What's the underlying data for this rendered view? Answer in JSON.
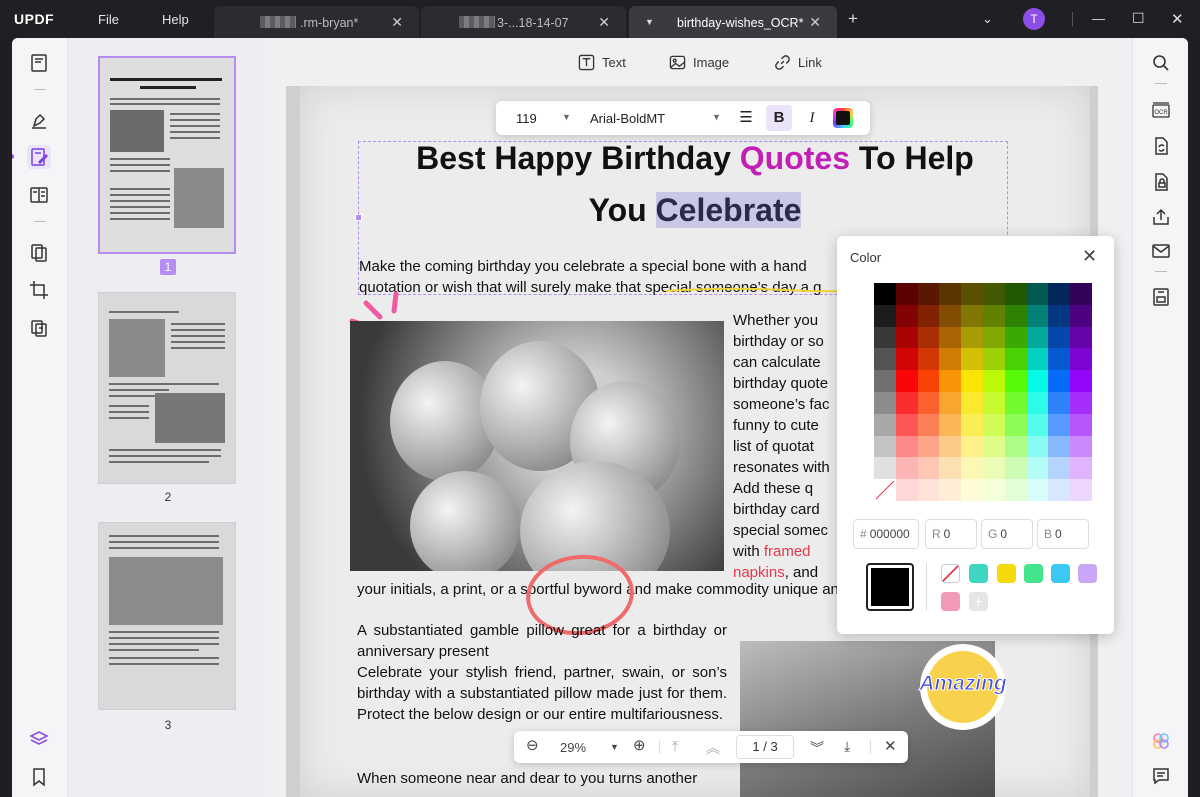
{
  "titlebar": {
    "logo": "UPDF",
    "menus": [
      "File",
      "Help"
    ],
    "tabs": [
      {
        "label": ".rm-bryan*"
      },
      {
        "label": "3-...18-14-07"
      },
      {
        "label": "birthday-wishes_OCR*"
      }
    ],
    "avatar_initial": "T"
  },
  "modes": {
    "text": "Text",
    "image": "Image",
    "link": "Link"
  },
  "thumbnails": [
    {
      "num": "1"
    },
    {
      "num": "2"
    },
    {
      "num": "3"
    }
  ],
  "format_toolbar": {
    "font_size": "119",
    "font_name": "Arial-BoldMT",
    "bold": "B",
    "italic": "I"
  },
  "document": {
    "title_part1": "Best Happy Birthday ",
    "title_quotes": "Quotes",
    "title_part2": " To Help",
    "title_line2_a": "You ",
    "title_line2_b": "Celebrate",
    "para1_line1": "Make the coming birthday you celebrate a special bone with a hand",
    "para1_line2": "quotation or wish that will surely make that special someone’s day a g",
    "col_lines": [
      "Whether you",
      "birthday or so",
      "can calculate",
      "birthday quote",
      "someone’s fac",
      "funny to cute",
      "list of quotat",
      "resonates with",
      "Add these q",
      "birthday card",
      "special somec"
    ],
    "col_with": "with ",
    "col_framed": "framed",
    "col_napkins": "napkins",
    "col_and": ", and",
    "para_initials": "your initials, a print, or a sportful byword and make commodity unique and indelible.",
    "para2": "A substantiated gamble pillow great for a birthday or anniversary present",
    "para3": "Celebrate your stylish friend, partner, swain, or son’s birthday with a substantiated pillow made just for them. Protect the below design or our entire multifariousness.",
    "para4": "When someone near and dear to you turns another",
    "sticker": "Amazing"
  },
  "color_popover": {
    "title": "Color",
    "hex_label": "#",
    "hex_value": "000000",
    "r_label": "R",
    "r_value": "0",
    "g_label": "G",
    "g_value": "0",
    "b_label": "B",
    "b_value": "0",
    "current_color": "#000000",
    "recent_swatches": [
      "#3fd6c1",
      "#f5d90a",
      "#43e58a",
      "#3bc8f5",
      "#c9a6f7",
      "#f29ab8"
    ]
  },
  "nav_bar": {
    "zoom": "29%",
    "page_current": "1",
    "page_sep": "/",
    "page_total": "3"
  },
  "accent": "#b58cf2"
}
